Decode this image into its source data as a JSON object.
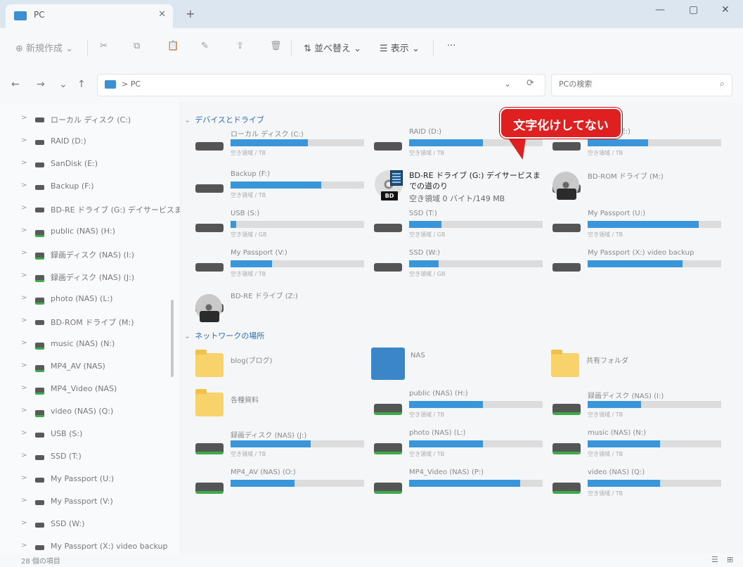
{
  "titlebar": {
    "tab_label": "PC",
    "close_tab": "✕",
    "new_tab": "+",
    "minimize": "—",
    "maximize": "▢",
    "close": "✕"
  },
  "commands": {
    "new": "新規作成",
    "new_arrow": "⌄",
    "cut": "✂",
    "copy": "⧉",
    "paste": "📋",
    "rename": "✎",
    "share": "⇪",
    "delete": "🗑",
    "sort": "並べ替え",
    "view": "表示",
    "more": "···"
  },
  "address": {
    "back": "←",
    "forward": "→",
    "down": "⌄",
    "up": "↑",
    "path": "> PC",
    "dropdown": "⌄",
    "refresh": "⟳"
  },
  "search": {
    "placeholder": "PCの検索",
    "icon": "⌕"
  },
  "sidebar": {
    "items": [
      {
        "label": "ローカル ディスク (C:)"
      },
      {
        "label": "RAID (D:)"
      },
      {
        "label": "SanDisk (E:)"
      },
      {
        "label": "Backup (F:)"
      },
      {
        "label": "BD-RE ドライブ (G:) デイサービスまで"
      },
      {
        "label": "public (NAS) (H:)"
      },
      {
        "label": "録画ディスク (NAS) (I:)"
      },
      {
        "label": "録画ディスク (NAS) (J:)"
      },
      {
        "label": "photo (NAS) (L:)"
      },
      {
        "label": "BD-ROM ドライブ (M:)"
      },
      {
        "label": "music (NAS) (N:)"
      },
      {
        "label": "MP4_AV (NAS)"
      },
      {
        "label": "MP4_Video (NAS)"
      },
      {
        "label": "video (NAS) (Q:)"
      },
      {
        "label": "USB (S:)"
      },
      {
        "label": "SSD (T:)"
      },
      {
        "label": "My Passport (U:)"
      },
      {
        "label": "My Passport (V:)"
      },
      {
        "label": "SSD (W:)"
      },
      {
        "label": "My Passport (X:) video backup"
      }
    ]
  },
  "sections": {
    "devices": "デバイスとドライブ",
    "network": "ネットワークの場所",
    "chev": "⌄"
  },
  "drives": [
    {
      "name": "ローカル ディスク (C:)",
      "free": "空き領域 / TB",
      "used": 0.58
    },
    {
      "name": "RAID (D:)",
      "free": "空き領域 / TB",
      "used": 0.55
    },
    {
      "name": "SanDisk (E:)",
      "free": "空き領域 / TB",
      "used": 0.45
    },
    {
      "name": "Backup (F:)",
      "free": "空き領域 / TB",
      "used": 0.68
    },
    {
      "name": "BD-ROM ドライブ (M:)",
      "free": "",
      "used": 0
    },
    {
      "name": "USB (S:)",
      "free": "空き領域 / GB",
      "used": 0.04
    },
    {
      "name": "SSD (T:)",
      "free": "空き領域 / GB",
      "used": 0.24
    },
    {
      "name": "My Passport (U:)",
      "free": "空き領域 / TB",
      "used": 0.83
    },
    {
      "name": "My Passport (V:)",
      "free": "空き領域 / TB",
      "used": 0.31
    },
    {
      "name": "SSD (W:)",
      "free": "空き領域 / GB",
      "used": 0.22
    },
    {
      "name": "My Passport (X:) video backup",
      "free": "",
      "used": 0.71
    },
    {
      "name": "BD-RE ドライブ (Z:)",
      "free": "",
      "used": 0
    }
  ],
  "bdre": {
    "badge": "BD",
    "name": "BD-RE ドライブ (G:) デイサービスまでの道のり",
    "free": "空き領域 0 バイト/149 MB"
  },
  "network": {
    "folders": [
      {
        "name": "blog(ブログ)"
      },
      {
        "name": "NAS"
      },
      {
        "name": "共有フォルダ"
      },
      {
        "name": "各種資料"
      }
    ],
    "drives": [
      {
        "name": "public (NAS) (H:)",
        "free": "空き領域 / TB",
        "used": 0.55
      },
      {
        "name": "録画ディスク (NAS) (I:)",
        "free": "空き領域 / TB",
        "used": 0.4
      },
      {
        "name": "録画ディスク (NAS) (J:)",
        "free": "空き領域 / TB",
        "used": 0.6
      },
      {
        "name": "photo (NAS) (L:)",
        "free": "空き領域 / TB",
        "used": 0.55
      },
      {
        "name": "music (NAS) (N:)",
        "free": "空き領域 / TB",
        "used": 0.54
      },
      {
        "name": "MP4_AV (NAS) (O:)",
        "free": "",
        "used": 0.48
      },
      {
        "name": "MP4_Video (NAS) (P:)",
        "free": "",
        "used": 0.83
      },
      {
        "name": "video (NAS) (Q:)",
        "free": "空き領域 / TB",
        "used": 0.54
      }
    ]
  },
  "callout": {
    "text": "文字化けしてない"
  },
  "status": {
    "count": "28 個の項目",
    "details": "☰",
    "tiles": "⊞"
  },
  "colors": {
    "accent": "#3a96d8",
    "callout": "#e02020"
  }
}
